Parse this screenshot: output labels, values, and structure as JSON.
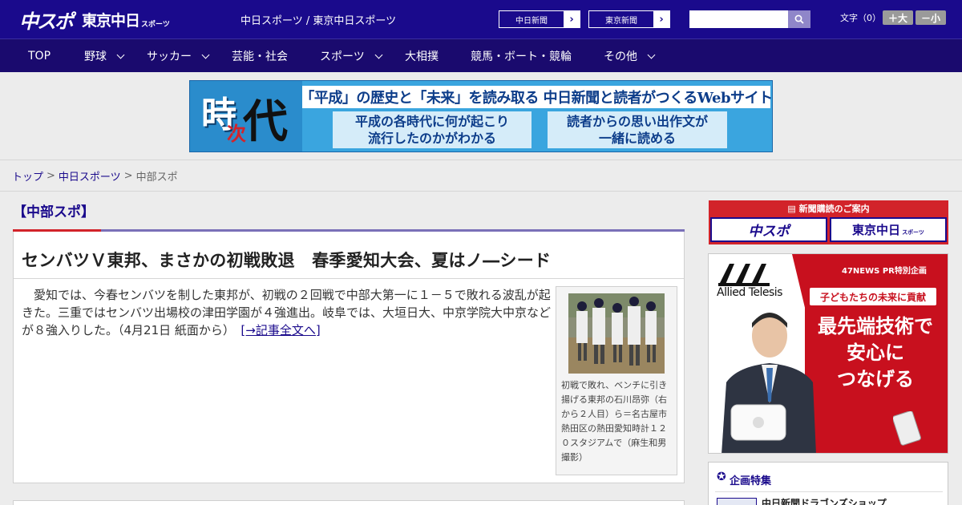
{
  "header": {
    "logo_chunichi_sports": "中スポ",
    "logo_tokyo_chunichi": "東京中日",
    "logo_sports_small": "スポーツ",
    "site_title": "中日スポーツ / 東京中日スポーツ",
    "ext_links": [
      "中日新聞",
      "東京新聞"
    ],
    "search_placeholder": "",
    "font_size_label": "文字（0）",
    "font_up": "＋大",
    "font_down": "－小"
  },
  "nav": {
    "items": [
      {
        "label": "TOP",
        "has_dropdown": false
      },
      {
        "label": "野球",
        "has_dropdown": true
      },
      {
        "label": "サッカー",
        "has_dropdown": true
      },
      {
        "label": "芸能・社会",
        "has_dropdown": false
      },
      {
        "label": "スポーツ",
        "has_dropdown": true
      },
      {
        "label": "大相撲",
        "has_dropdown": false
      },
      {
        "label": "競馬・ボート・競輪",
        "has_dropdown": false
      },
      {
        "label": "その他",
        "has_dropdown": true
      }
    ]
  },
  "banner": {
    "logo_main": "時",
    "logo_sub": "次",
    "logo_end": "代",
    "headline": "「平成」の歴史と「未来」を読み取る 中日新聞と読者がつくるWebサイト",
    "box_left_line1": "平成の各時代に何が起こり",
    "box_left_line2": "流行したのかがわかる",
    "box_right_line1": "読者からの思い出作文が",
    "box_right_line2": "一緒に読める"
  },
  "breadcrumb": {
    "items": [
      "トップ",
      "中日スポーツ",
      "中部スポ"
    ],
    "separator": ">"
  },
  "main": {
    "section_title": "【中部スポ】",
    "article": {
      "title": "センバツＶ東邦、まさかの初戦敗退　春季愛知大会、夏はノ―シード",
      "body": "愛知では、今春センバツを制した東邦が、初戦の２回戦で中部大第一に１－５で敗れる波乱が起きた。三重ではセンバツ出場校の津田学園が４強進出。岐阜では、大垣日大、中京学院大中京などが８強入りした。（4月21日 紙面から）",
      "more_link": "[→記事全文へ]",
      "photo_caption": "初戦で敗れ、ベンチに引き揚げる東邦の石川昂弥（右から２人目）ら＝名古屋市熱田区の熱田愛知時計１２０スタジアムで（麻生和男撮影）"
    }
  },
  "sidebar": {
    "subscribe_heading": "新聞購読のご案内",
    "subscribe_left": "中スポ",
    "subscribe_right": "東京中日",
    "subscribe_right_small": "スポーツ",
    "ad": {
      "brand": "Allied Telesis",
      "pr_label": "47NEWS PR特別企画",
      "pill": "子どもたちの未来に貢献",
      "line1": "最先端技術で",
      "line2": "安心に",
      "line3": "つなげる"
    },
    "feature_title": "企画特集",
    "feature_item": "中日新聞ドラゴンズショップ"
  },
  "colors": {
    "header_bg": "#1a0a8c",
    "nav_bg": "#1a0a6e",
    "accent_red": "#d2232a",
    "link": "#1a0a8c"
  }
}
